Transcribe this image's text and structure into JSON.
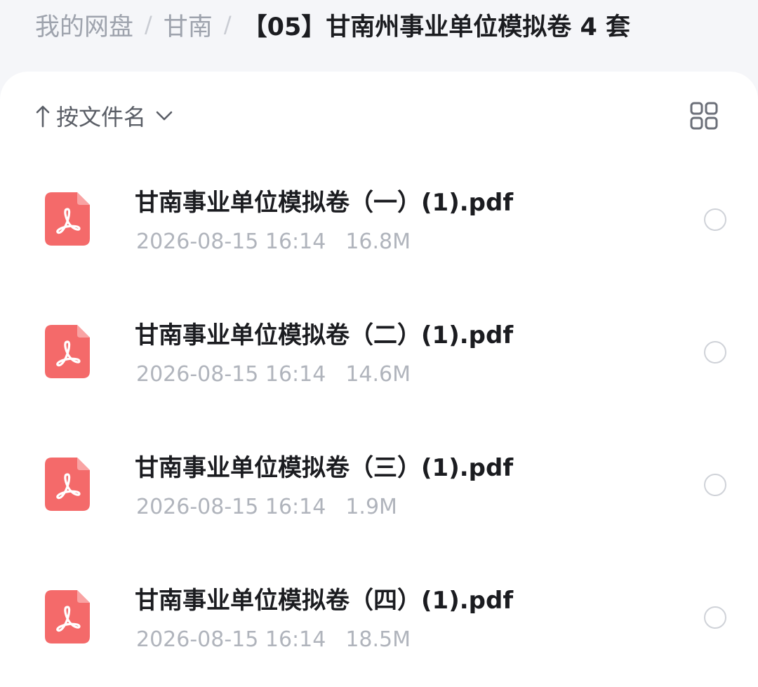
{
  "breadcrumb": {
    "items": [
      "我的网盘",
      "甘南",
      "【05】甘南州事业单位模拟卷 4 套"
    ],
    "separator": "/"
  },
  "toolbar": {
    "sort_label": "按文件名",
    "sort_direction_icon": "arrow-up-icon",
    "sort_menu_icon": "chevron-down-icon",
    "view_toggle_icon": "grid-view-icon"
  },
  "files": [
    {
      "name": "甘南事业单位模拟卷（一）(1).pdf",
      "date": "2026-08-15 16:14",
      "size": "16.8M",
      "icon": "pdf-icon",
      "selected": false
    },
    {
      "name": "甘南事业单位模拟卷（二）(1).pdf",
      "date": "2026-08-15 16:14",
      "size": "14.6M",
      "icon": "pdf-icon",
      "selected": false
    },
    {
      "name": "甘南事业单位模拟卷（三）(1).pdf",
      "date": "2026-08-15 16:14",
      "size": "1.9M",
      "icon": "pdf-icon",
      "selected": false
    },
    {
      "name": "甘南事业单位模拟卷（四）(1).pdf",
      "date": "2026-08-15 16:14",
      "size": "18.5M",
      "icon": "pdf-icon",
      "selected": false
    }
  ],
  "colors": {
    "pdf_icon": "#f46a6a",
    "page_background": "#f5f6f9",
    "panel_background": "#ffffff",
    "primary_text": "#1b1c20",
    "muted_text": "#b0b4bc"
  }
}
